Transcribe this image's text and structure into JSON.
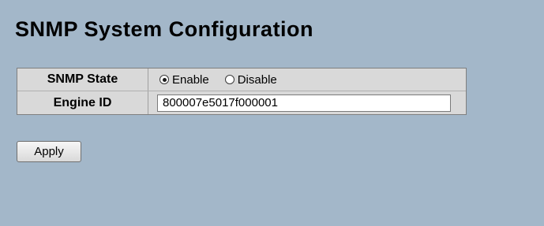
{
  "page": {
    "title": "SNMP System Configuration"
  },
  "snmp_state": {
    "label": "SNMP State",
    "options": [
      {
        "label": "Enable",
        "selected": true
      },
      {
        "label": "Disable",
        "selected": false
      }
    ]
  },
  "engine_id": {
    "label": "Engine ID",
    "value": "800007e5017f000001"
  },
  "actions": {
    "apply_label": "Apply"
  }
}
